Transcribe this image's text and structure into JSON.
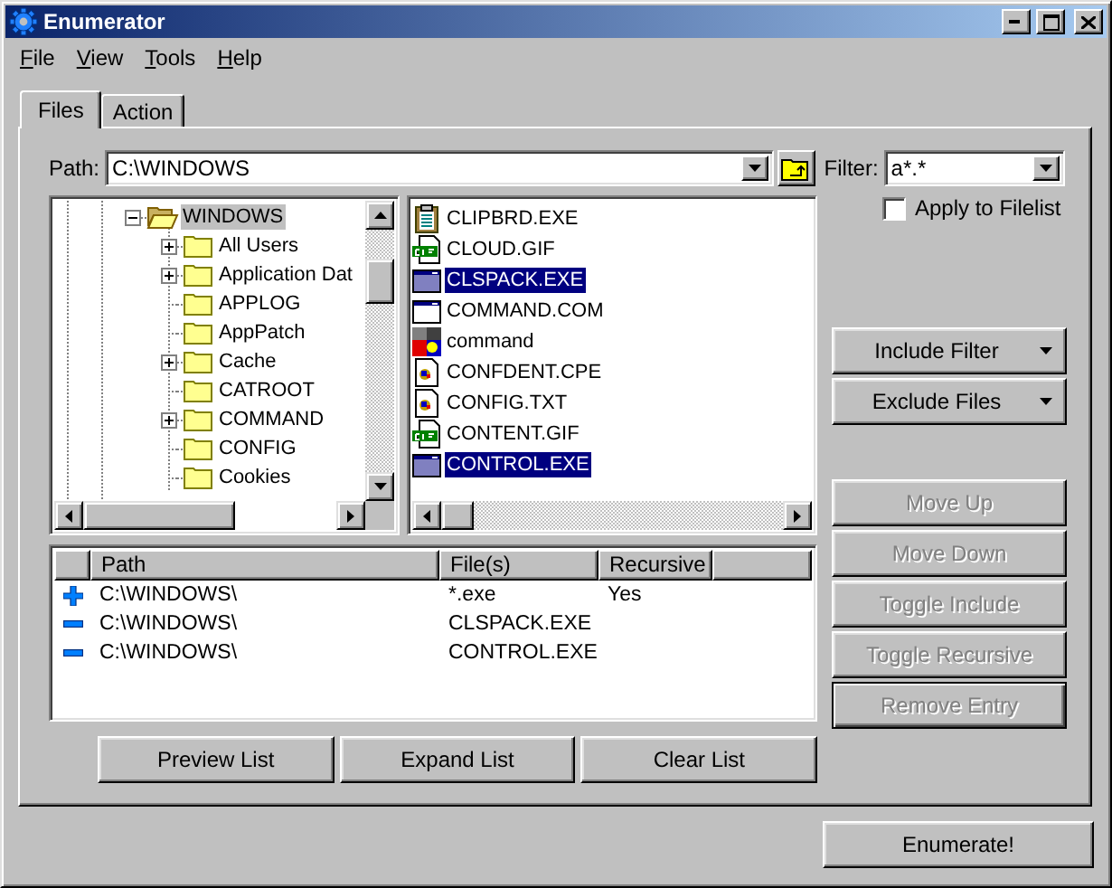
{
  "window": {
    "title": "Enumerator"
  },
  "menu": [
    "File",
    "View",
    "Tools",
    "Help"
  ],
  "tabs": [
    {
      "label": "Files",
      "selected": true
    },
    {
      "label": "Action",
      "selected": false
    }
  ],
  "path": {
    "label": "Path:",
    "value": "C:\\WINDOWS"
  },
  "filter": {
    "label": "Filter:",
    "value": "a*.*"
  },
  "apply_to_filelist": {
    "label": "Apply to Filelist",
    "checked": false
  },
  "tree": {
    "items": [
      {
        "label": "WINDOWS",
        "selected": true,
        "expanded": true,
        "has_children": true,
        "children": [
          {
            "label": "All Users",
            "selected": false,
            "expanded": false,
            "has_children": true
          },
          {
            "label": "Application Dat",
            "selected": false,
            "expanded": false,
            "has_children": true
          },
          {
            "label": "APPLOG",
            "selected": false,
            "has_children": false
          },
          {
            "label": "AppPatch",
            "selected": false,
            "has_children": false
          },
          {
            "label": "Cache",
            "selected": false,
            "expanded": false,
            "has_children": true
          },
          {
            "label": "CATROOT",
            "selected": false,
            "has_children": false
          },
          {
            "label": "COMMAND",
            "selected": false,
            "expanded": false,
            "has_children": true
          },
          {
            "label": "CONFIG",
            "selected": false,
            "has_children": false
          },
          {
            "label": "Cookies",
            "selected": false,
            "has_children": false
          }
        ]
      }
    ]
  },
  "files": [
    {
      "name": "CLIPBRD.EXE",
      "kind": "clipboard",
      "selected": false
    },
    {
      "name": "CLOUD.GIF",
      "kind": "gif",
      "selected": false
    },
    {
      "name": "CLSPACK.EXE",
      "kind": "app",
      "selected": true
    },
    {
      "name": "COMMAND.COM",
      "kind": "app",
      "selected": false
    },
    {
      "name": "command",
      "kind": "dos",
      "selected": false
    },
    {
      "name": "CONFDENT.CPE",
      "kind": "document",
      "selected": false
    },
    {
      "name": "CONFIG.TXT",
      "kind": "document",
      "selected": false
    },
    {
      "name": "CONTENT.GIF",
      "kind": "gif",
      "selected": false
    },
    {
      "name": "CONTROL.EXE",
      "kind": "app",
      "selected": true
    }
  ],
  "entries": {
    "columns": [
      "Path",
      "File(s)",
      "Recursive"
    ],
    "rows": [
      {
        "kind": "include",
        "path": "C:\\WINDOWS\\",
        "files": "*.exe",
        "recursive": "Yes"
      },
      {
        "kind": "exclude",
        "path": "C:\\WINDOWS\\",
        "files": "CLSPACK.EXE"
      },
      {
        "kind": "exclude",
        "path": "C:\\WINDOWS\\",
        "files": "CONTROL.EXE"
      }
    ]
  },
  "filter_buttons": [
    {
      "label": "Include Filter",
      "dropdown": true
    },
    {
      "label": "Exclude Files",
      "dropdown": true
    }
  ],
  "entry_buttons": [
    {
      "label": "Move Up",
      "disabled": true,
      "default": false
    },
    {
      "label": "Move Down",
      "disabled": true,
      "default": false
    },
    {
      "label": "Toggle Include",
      "disabled": true,
      "default": false
    },
    {
      "label": "Toggle Recursive",
      "disabled": true,
      "default": false
    },
    {
      "label": "Remove Entry",
      "disabled": true,
      "default": true
    }
  ],
  "list_buttons": [
    "Preview List",
    "Expand List",
    "Clear List"
  ],
  "enumerate_button": "Enumerate!"
}
